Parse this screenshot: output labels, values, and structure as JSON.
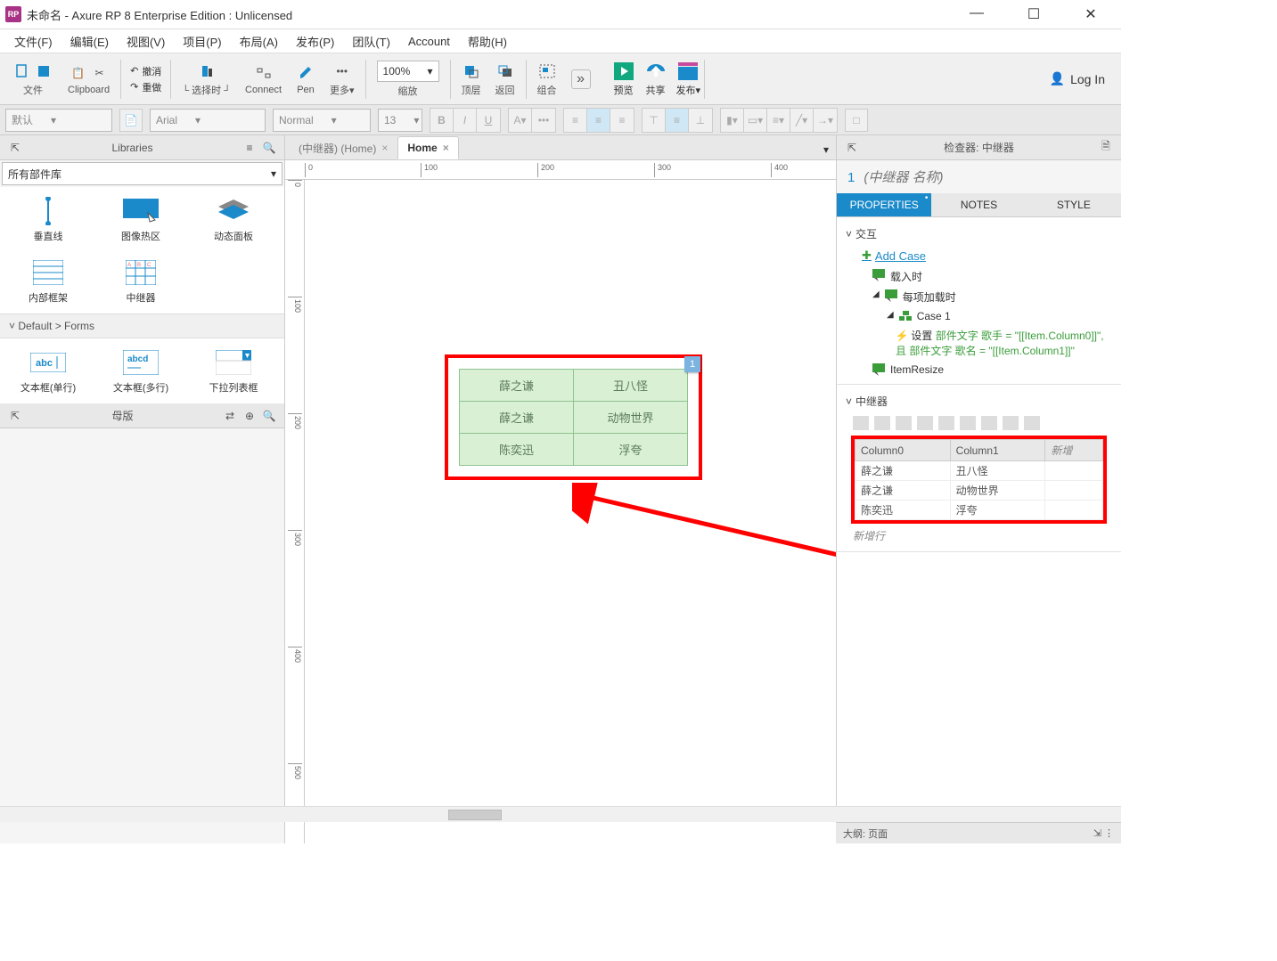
{
  "titlebar": {
    "title": "未命名 - Axure RP 8 Enterprise Edition : Unlicensed"
  },
  "menubar": {
    "items": [
      "文件(F)",
      "编辑(E)",
      "视图(V)",
      "项目(P)",
      "布局(A)",
      "发布(P)",
      "团队(T)",
      "Account",
      "帮助(H)"
    ]
  },
  "toolbar": {
    "file": "文件",
    "clipboard": "Clipboard",
    "undo": "撤消",
    "redo": "重做",
    "select_mode": "选择时",
    "connect": "Connect",
    "pen": "Pen",
    "more": "更多",
    "zoom_label": "缩放",
    "zoom_value": "100%",
    "top_layer": "顶层",
    "back": "返回",
    "group": "组合",
    "preview": "预览",
    "share": "共享",
    "publish": "发布",
    "login": "Log In"
  },
  "formatbar": {
    "style": "默认",
    "font": "Arial",
    "weight": "Normal",
    "size": "13"
  },
  "left": {
    "libraries_title": "Libraries",
    "all_libs": "所有部件库",
    "widgets1": [
      "垂直线",
      "图像热区",
      "动态面板"
    ],
    "widgets2": [
      "内部框架",
      "中继器"
    ],
    "forms_section": "Default > Forms",
    "widgets3": [
      "文本框(单行)",
      "文本框(多行)",
      "下拉列表框"
    ],
    "masters_title": "母版"
  },
  "tabs": {
    "inactive": "(中继器) (Home)",
    "active": "Home"
  },
  "ruler_h": [
    "0",
    "100",
    "200",
    "300",
    "400"
  ],
  "ruler_v": [
    "0",
    "100",
    "200",
    "300",
    "400",
    "500"
  ],
  "repeater": {
    "badge": "1",
    "rows": [
      {
        "c0": "薛之谦",
        "c1": "丑八怪"
      },
      {
        "c0": "薛之谦",
        "c1": "动物世界"
      },
      {
        "c0": "陈奕迅",
        "c1": "浮夸"
      }
    ]
  },
  "inspector": {
    "title_prefix": "检查器: 中继器",
    "num": "1",
    "name": "(中继器 名称)",
    "tab_props": "PROPERTIES",
    "tab_notes": "NOTES",
    "tab_style": "STYLE",
    "section_ix": "交互",
    "add_case": "Add Case",
    "onload": "载入时",
    "each_load": "每项加载时",
    "case1": "Case 1",
    "action_label": "设置",
    "action_text": "部件文字 歌手 = \"[[Item.Column0]]\", 且 部件文字 歌名 = \"[[Item.Column1]]\"",
    "item_resize": "ItemResize",
    "section_rep": "中继器",
    "grid_cols": [
      "Column0",
      "Column1"
    ],
    "add_col": "新增",
    "new_row": "新增行",
    "footer": "大纲: 页面"
  }
}
